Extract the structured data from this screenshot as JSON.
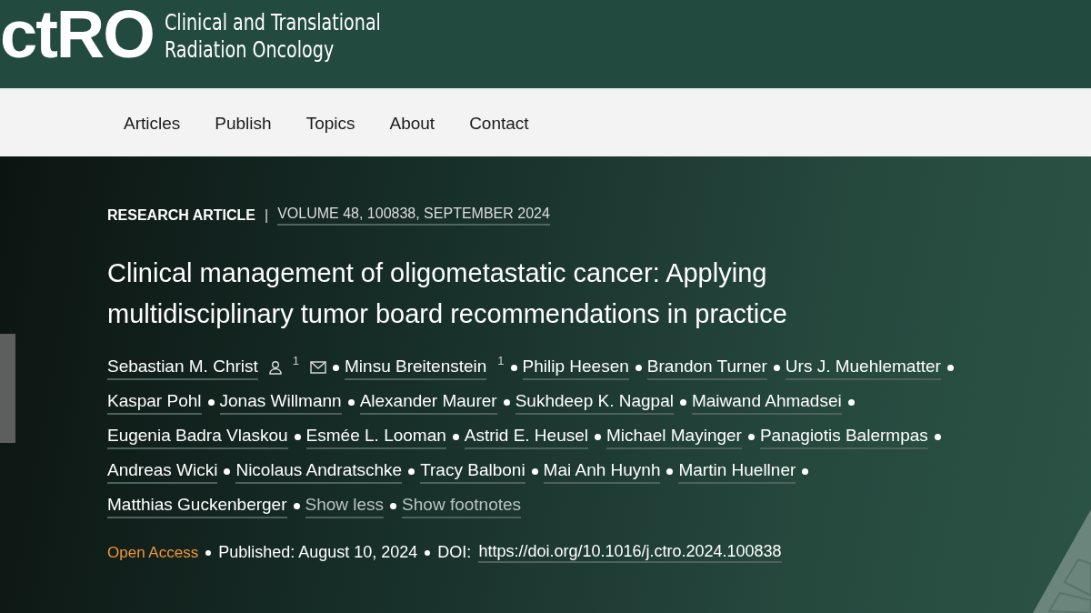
{
  "header": {
    "logo": "ctRO",
    "journal_name": [
      "Clinical and Translational",
      "Radiation Oncology"
    ]
  },
  "nav": {
    "items": [
      "Articles",
      "Publish",
      "Topics",
      "About",
      "Contact"
    ]
  },
  "article": {
    "type": "RESEARCH ARTICLE",
    "separator": "|",
    "citation": "VOLUME 48, 100838, SEPTEMBER 2024",
    "title": "Clinical management of oligometastatic cancer: Applying multidisciplinary tumor board recommendations in practice",
    "authors": [
      {
        "name": "Sebastian M. Christ",
        "corresponding": true,
        "footnote": "1",
        "email": true
      },
      {
        "name": "Minsu Breitenstein",
        "footnote": "1"
      },
      {
        "name": "Philip Heesen"
      },
      {
        "name": "Brandon Turner"
      },
      {
        "name": "Urs J. Muehlematter"
      },
      {
        "name": "Kaspar Pohl"
      },
      {
        "name": "Jonas Willmann"
      },
      {
        "name": "Alexander Maurer"
      },
      {
        "name": "Sukhdeep K. Nagpal"
      },
      {
        "name": "Maiwand Ahmadsei"
      },
      {
        "name": "Eugenia Badra Vlaskou"
      },
      {
        "name": "Esmée L. Looman"
      },
      {
        "name": "Astrid E. Heusel"
      },
      {
        "name": "Michael Mayinger"
      },
      {
        "name": "Panagiotis Balermpas"
      },
      {
        "name": "Andreas Wicki"
      },
      {
        "name": "Nicolaus Andratschke"
      },
      {
        "name": "Tracy Balboni"
      },
      {
        "name": "Mai Anh Huynh"
      },
      {
        "name": "Martin Huellner"
      },
      {
        "name": "Matthias Guckenberger"
      }
    ],
    "toggles": [
      "Show less",
      "Show footnotes"
    ],
    "access": "Open Access",
    "published": "Published: August 10, 2024",
    "doi_label": "DOI:",
    "doi": "https://doi.org/10.1016/j.ctro.2024.100838"
  }
}
